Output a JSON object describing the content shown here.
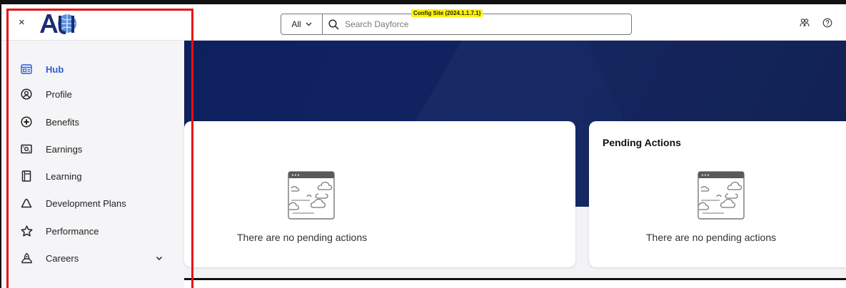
{
  "header": {
    "close_glyph": "×",
    "config_badge": "Config Site (2024.1.1.7.1)",
    "search": {
      "scope_label": "All",
      "placeholder": "Search Dayforce"
    },
    "right_icons": [
      "people-icon",
      "help-icon"
    ]
  },
  "sidebar": {
    "items": [
      {
        "label": "Hub",
        "icon": "hub-icon",
        "active": true
      },
      {
        "label": "Profile",
        "icon": "profile-icon"
      },
      {
        "label": "Benefits",
        "icon": "benefits-icon"
      },
      {
        "label": "Earnings",
        "icon": "earnings-icon"
      },
      {
        "label": "Learning",
        "icon": "learning-icon"
      },
      {
        "label": "Development Plans",
        "icon": "development-icon"
      },
      {
        "label": "Performance",
        "icon": "star-icon"
      },
      {
        "label": "Careers",
        "icon": "careers-icon",
        "expandable": true
      }
    ]
  },
  "cards": [
    {
      "title": "",
      "empty_text": "There are no pending actions"
    },
    {
      "title": "Pending Actions",
      "empty_text": "There are no pending actions"
    }
  ],
  "colors": {
    "banner": "#0e1f5d",
    "active_nav": "#2a5bd7",
    "highlight_box": "#e81010",
    "badge": "#fff200"
  }
}
